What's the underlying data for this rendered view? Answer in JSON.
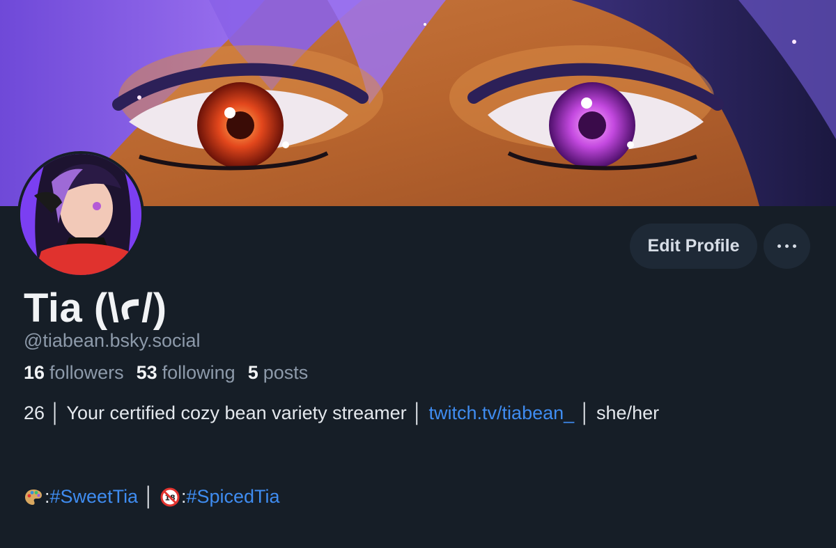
{
  "profile": {
    "display_name": "Tia (\\ꜥ/)",
    "handle": "@tiabean.bsky.social",
    "stats": {
      "followers_count": "16",
      "followers_label": "followers",
      "following_count": "53",
      "following_label": "following",
      "posts_count": "5",
      "posts_label": "posts"
    },
    "bio": {
      "part1": "26 │ Your certified cozy bean variety streamer │ ",
      "link": "twitch.tv/tiabean_",
      "part2": " │ she/her"
    },
    "tags": {
      "icon1": "palette-icon",
      "sep1": ": ",
      "tag1": "#SweetTia",
      "divider": " │ ",
      "icon2": "no-under-18-icon",
      "sep2": ": ",
      "tag2": "#SpicedTia"
    }
  },
  "actions": {
    "edit_profile_label": "Edit Profile",
    "more_icon": "more-horizontal-icon"
  },
  "colors": {
    "background": "#161e27",
    "button_bg": "#1e2936",
    "link": "#3f8cf0",
    "muted_text": "#8d9aaa",
    "primary_text": "#f1f3f5"
  }
}
